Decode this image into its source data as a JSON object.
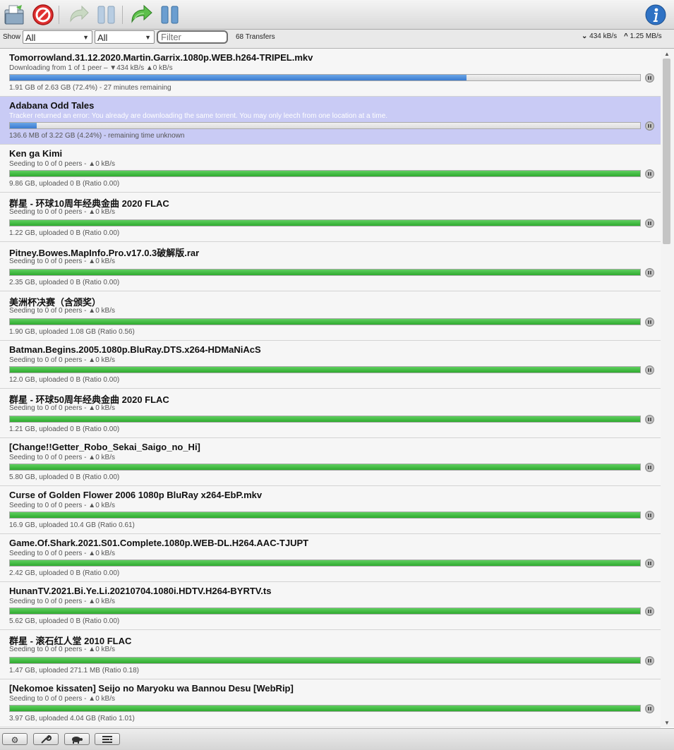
{
  "toolbar": {
    "icons": [
      "open-torrent-icon",
      "remove-icon",
      "resume-selected-icon",
      "pause-selected-icon",
      "resume-all-icon",
      "pause-all-icon",
      "inspector-icon"
    ]
  },
  "filterbar": {
    "show_label": "Show",
    "status_filter": "All",
    "tracker_filter": "All",
    "filter_placeholder": "Filter",
    "transfers_count": "68 Transfers",
    "download_speed": "434 kB/s",
    "upload_speed": "1.25 MB/s"
  },
  "torrents": [
    {
      "name": "Tomorrowland.31.12.2020.Martin.Garrix.1080p.WEB.h264-TRIPEL.mkv",
      "peers": "Downloading from 1 of 1 peer – ▼434 kB/s ▲0 kB/s",
      "progress": "1.91 GB of 2.63 GB (72.4%) - 27 minutes remaining",
      "percent": 72.4,
      "state": "downloading",
      "selected": false
    },
    {
      "name": "Adabana Odd Tales",
      "peers": "Tracker returned an error: You already are downloading the same torrent. You may only leech from one location at a time.",
      "progress": "136.6 MB of 3.22 GB (4.24%) - remaining time unknown",
      "percent": 4.24,
      "state": "downloading",
      "selected": true
    },
    {
      "name": "Ken ga Kimi",
      "peers": "Seeding to 0 of 0 peers - ▲0 kB/s",
      "progress": "9.86 GB, uploaded 0 B (Ratio 0.00)",
      "percent": 100,
      "state": "seeding",
      "selected": false
    },
    {
      "name": "群星 - 环球10周年经典金曲 2020 FLAC",
      "peers": "Seeding to 0 of 0 peers - ▲0 kB/s",
      "progress": "1.22 GB, uploaded 0 B (Ratio 0.00)",
      "percent": 100,
      "state": "seeding",
      "selected": false
    },
    {
      "name": "Pitney.Bowes.MapInfo.Pro.v17.0.3破解版.rar",
      "peers": "Seeding to 0 of 0 peers - ▲0 kB/s",
      "progress": "2.35 GB, uploaded 0 B (Ratio 0.00)",
      "percent": 100,
      "state": "seeding",
      "selected": false
    },
    {
      "name": "美洲杯决赛（含颁奖）",
      "peers": "Seeding to 0 of 0 peers - ▲0 kB/s",
      "progress": "1.90 GB, uploaded 1.08 GB (Ratio 0.56)",
      "percent": 100,
      "state": "seeding",
      "selected": false
    },
    {
      "name": "Batman.Begins.2005.1080p.BluRay.DTS.x264-HDMaNiAcS",
      "peers": "Seeding to 0 of 0 peers - ▲0 kB/s",
      "progress": "12.0 GB, uploaded 0 B (Ratio 0.00)",
      "percent": 100,
      "state": "seeding",
      "selected": false
    },
    {
      "name": "群星 - 环球50周年经典金曲 2020 FLAC",
      "peers": "Seeding to 0 of 0 peers - ▲0 kB/s",
      "progress": "1.21 GB, uploaded 0 B (Ratio 0.00)",
      "percent": 100,
      "state": "seeding",
      "selected": false
    },
    {
      "name": "[Change!!Getter_Robo_Sekai_Saigo_no_Hi]",
      "peers": "Seeding to 0 of 0 peers - ▲0 kB/s",
      "progress": "5.80 GB, uploaded 0 B (Ratio 0.00)",
      "percent": 100,
      "state": "seeding",
      "selected": false
    },
    {
      "name": "Curse of Golden Flower 2006 1080p BluRay x264-EbP.mkv",
      "peers": "Seeding to 0 of 0 peers - ▲0 kB/s",
      "progress": "16.9 GB, uploaded 10.4 GB (Ratio 0.61)",
      "percent": 100,
      "state": "seeding",
      "selected": false
    },
    {
      "name": "Game.Of.Shark.2021.S01.Complete.1080p.WEB-DL.H264.AAC-TJUPT",
      "peers": "Seeding to 0 of 0 peers - ▲0 kB/s",
      "progress": "2.42 GB, uploaded 0 B (Ratio 0.00)",
      "percent": 100,
      "state": "seeding",
      "selected": false
    },
    {
      "name": "HunanTV.2021.Bi.Ye.Li.20210704.1080i.HDTV.H264-BYRTV.ts",
      "peers": "Seeding to 0 of 0 peers - ▲0 kB/s",
      "progress": "5.62 GB, uploaded 0 B (Ratio 0.00)",
      "percent": 100,
      "state": "seeding",
      "selected": false
    },
    {
      "name": "群星 - 滚石红人堂 2010 FLAC",
      "peers": "Seeding to 0 of 0 peers - ▲0 kB/s",
      "progress": "1.47 GB, uploaded 271.1 MB (Ratio 0.18)",
      "percent": 100,
      "state": "seeding",
      "selected": false
    },
    {
      "name": "[Nekomoe kissaten] Seijo no Maryoku wa Bannou Desu [WebRip]",
      "peers": "Seeding to 0 of 0 peers - ▲0 kB/s",
      "progress": "3.97 GB, uploaded 4.04 GB (Ratio 1.01)",
      "percent": 100,
      "state": "seeding",
      "selected": false
    }
  ],
  "bottombar": {
    "icons": [
      "settings-gear-icon",
      "preferences-wrench-icon",
      "turtle-speed-icon",
      "compact-view-icon"
    ]
  },
  "colors": {
    "download_bar": "#3a7bd1",
    "seed_bar": "#2faa2f",
    "selected_row": "#c9cbf5"
  }
}
